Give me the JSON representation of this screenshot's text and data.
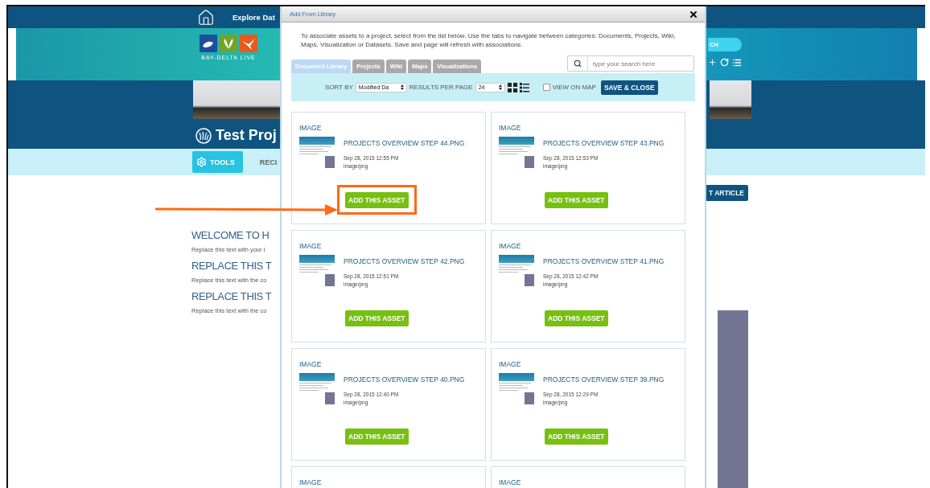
{
  "page": {
    "nav_link": "Explore Dat",
    "logo_text": "BAY-DELTA LIVE",
    "search_button": "CH",
    "project_title": "Test Proj",
    "toolbar": [
      {
        "label": "TOOLS",
        "selected": true
      },
      {
        "label": "RECI",
        "selected": false
      }
    ],
    "article_button": "T ARTICLE",
    "content": [
      {
        "kind": "heading",
        "text": "WELCOME TO H"
      },
      {
        "kind": "paragraph",
        "text": "Replace this text with your i"
      },
      {
        "kind": "heading",
        "text": "REPLACE THIS T"
      },
      {
        "kind": "paragraph",
        "text": "Replace this text with the co"
      },
      {
        "kind": "heading",
        "text": "REPLACE THIS T"
      },
      {
        "kind": "paragraph",
        "text": "Replace this text with the co"
      }
    ]
  },
  "dialog": {
    "title": "Add From Library",
    "description": "To associate assets to a project, select from the list below. Use the tabs to navigate between categories: Documents, Projects, Wiki, Maps, Visualization or Datasets. Save and page will refresh with associations.",
    "tabs": [
      {
        "label": "Document Library",
        "selected": true
      },
      {
        "label": "Projects",
        "selected": false
      },
      {
        "label": "Wiki",
        "selected": false
      },
      {
        "label": "Maps",
        "selected": false
      },
      {
        "label": "Visualizations",
        "selected": false
      }
    ],
    "search": {
      "placeholder": "type your search here"
    },
    "sort_label": "SORT BY",
    "sort_value": "Modified Da",
    "per_page_label": "RESULTS PER PAGE",
    "per_page_value": "24",
    "view_on_map": {
      "label": "VIEW ON MAP",
      "checked": false
    },
    "save_button": "SAVE & CLOSE",
    "assets": [
      {
        "type": "IMAGE",
        "title": "PROJECTS OVERVIEW STEP 44.PNG",
        "date": "Sep 28, 2015 12:55 PM",
        "mime": "image/png",
        "button": "ADD THIS ASSET",
        "highlighted": true
      },
      {
        "type": "IMAGE",
        "title": "PROJECTS OVERVIEW STEP 43.PNG",
        "date": "Sep 28, 2015 12:53 PM",
        "mime": "image/png",
        "button": "ADD THIS ASSET",
        "highlighted": false
      },
      {
        "type": "IMAGE",
        "title": "PROJECTS OVERVIEW STEP 42.PNG",
        "date": "Sep 28, 2015 12:51 PM",
        "mime": "image/png",
        "button": "ADD THIS ASSET",
        "highlighted": false
      },
      {
        "type": "IMAGE",
        "title": "PROJECTS OVERVIEW STEP 41.PNG",
        "date": "Sep 28, 2015 12:42 PM",
        "mime": "image/png",
        "button": "ADD THIS ASSET",
        "highlighted": false
      },
      {
        "type": "IMAGE",
        "title": "PROJECTS OVERVIEW STEP 40.PNG",
        "date": "Sep 28, 2015 12:40 PM",
        "mime": "image/png",
        "button": "ADD THIS ASSET",
        "highlighted": false
      },
      {
        "type": "IMAGE",
        "title": "PROJECTS OVERVIEW STEP 39.PNG",
        "date": "Sep 28, 2015 12:29 PM",
        "mime": "image/png",
        "button": "ADD THIS ASSET",
        "highlighted": false
      },
      {
        "type": "IMAGE"
      },
      {
        "type": "IMAGE"
      }
    ]
  }
}
